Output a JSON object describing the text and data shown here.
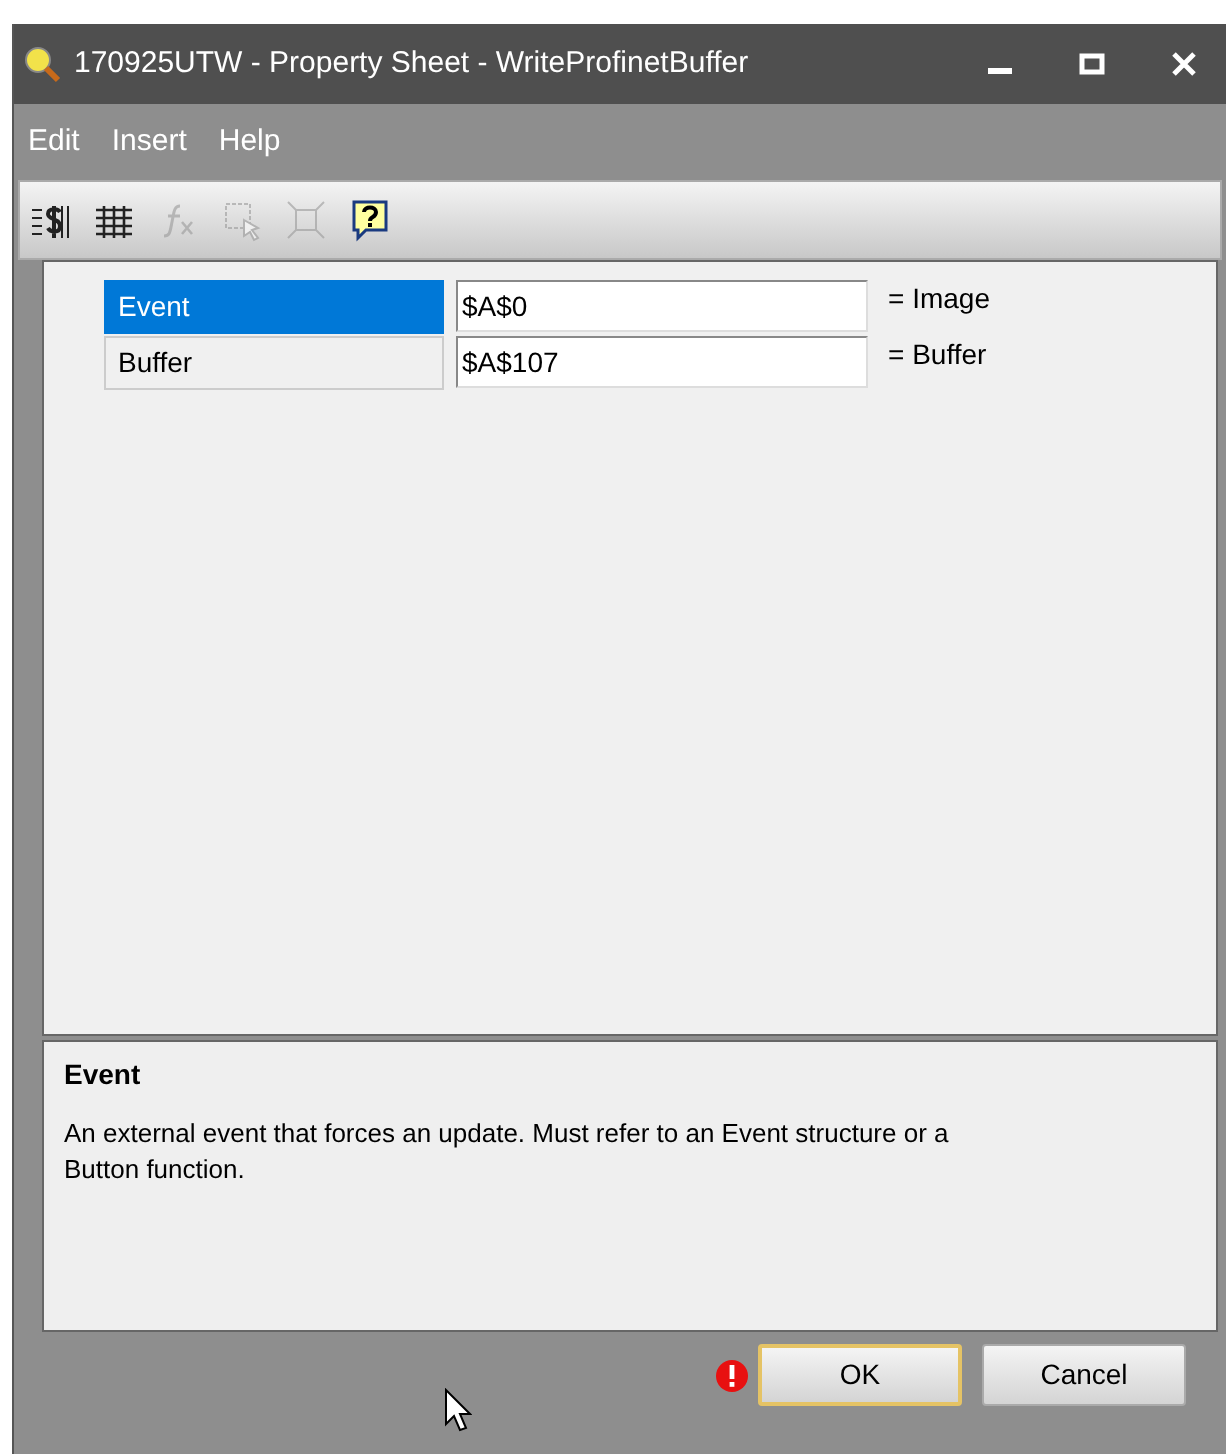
{
  "window": {
    "title": "170925UTW - Property Sheet - WriteProfinetBuffer"
  },
  "menu": [
    "Edit",
    "Insert",
    "Help"
  ],
  "toolbar": [
    {
      "kind": "dollar",
      "disabled": false
    },
    {
      "kind": "grid",
      "disabled": false
    },
    {
      "kind": "fx",
      "disabled": true
    },
    {
      "kind": "select",
      "disabled": true
    },
    {
      "kind": "expand",
      "disabled": true
    },
    {
      "kind": "help",
      "disabled": false
    }
  ],
  "properties": [
    {
      "name": "Event",
      "value": "$A$0",
      "note": "= Image",
      "selected": true
    },
    {
      "name": "Buffer",
      "value": "$A$107",
      "note": "= Buffer",
      "selected": false
    }
  ],
  "description": {
    "title": "Event",
    "text": "An external event that forces an update. Must refer to an Event structure or a Button function."
  },
  "buttons": [
    {
      "label": "OK",
      "default": true,
      "warning": true
    },
    {
      "label": "Cancel",
      "default": false,
      "warning": false
    }
  ]
}
